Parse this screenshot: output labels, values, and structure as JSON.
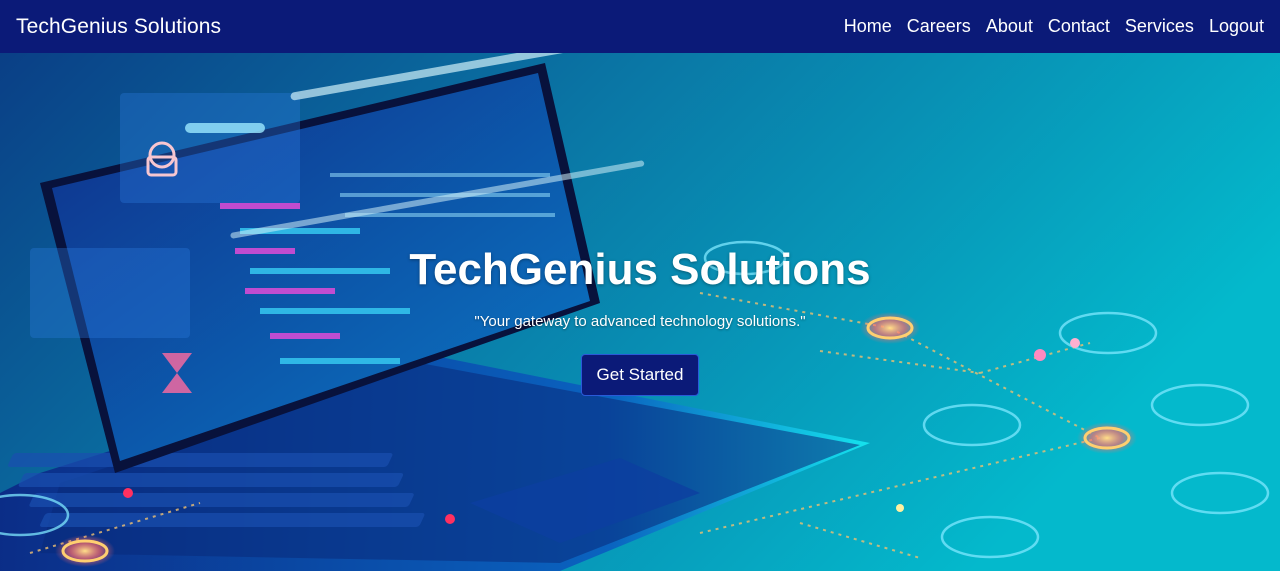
{
  "navbar": {
    "brand": "TechGenius Solutions",
    "links": [
      "Home",
      "Careers",
      "About",
      "Contact",
      "Services",
      "Logout"
    ]
  },
  "hero": {
    "title": "TechGenius Solutions",
    "tagline": "\"Your gateway to advanced technology solutions.\"",
    "cta_label": "Get Started",
    "background_image": "laptop-tech-illustration"
  },
  "colors": {
    "navbar_bg": "#0b1a78",
    "cta_bg": "#0b1a78",
    "hero_bg_dark": "#073a78",
    "hero_bg_light": "#00b8c8",
    "text": "#ffffff"
  }
}
